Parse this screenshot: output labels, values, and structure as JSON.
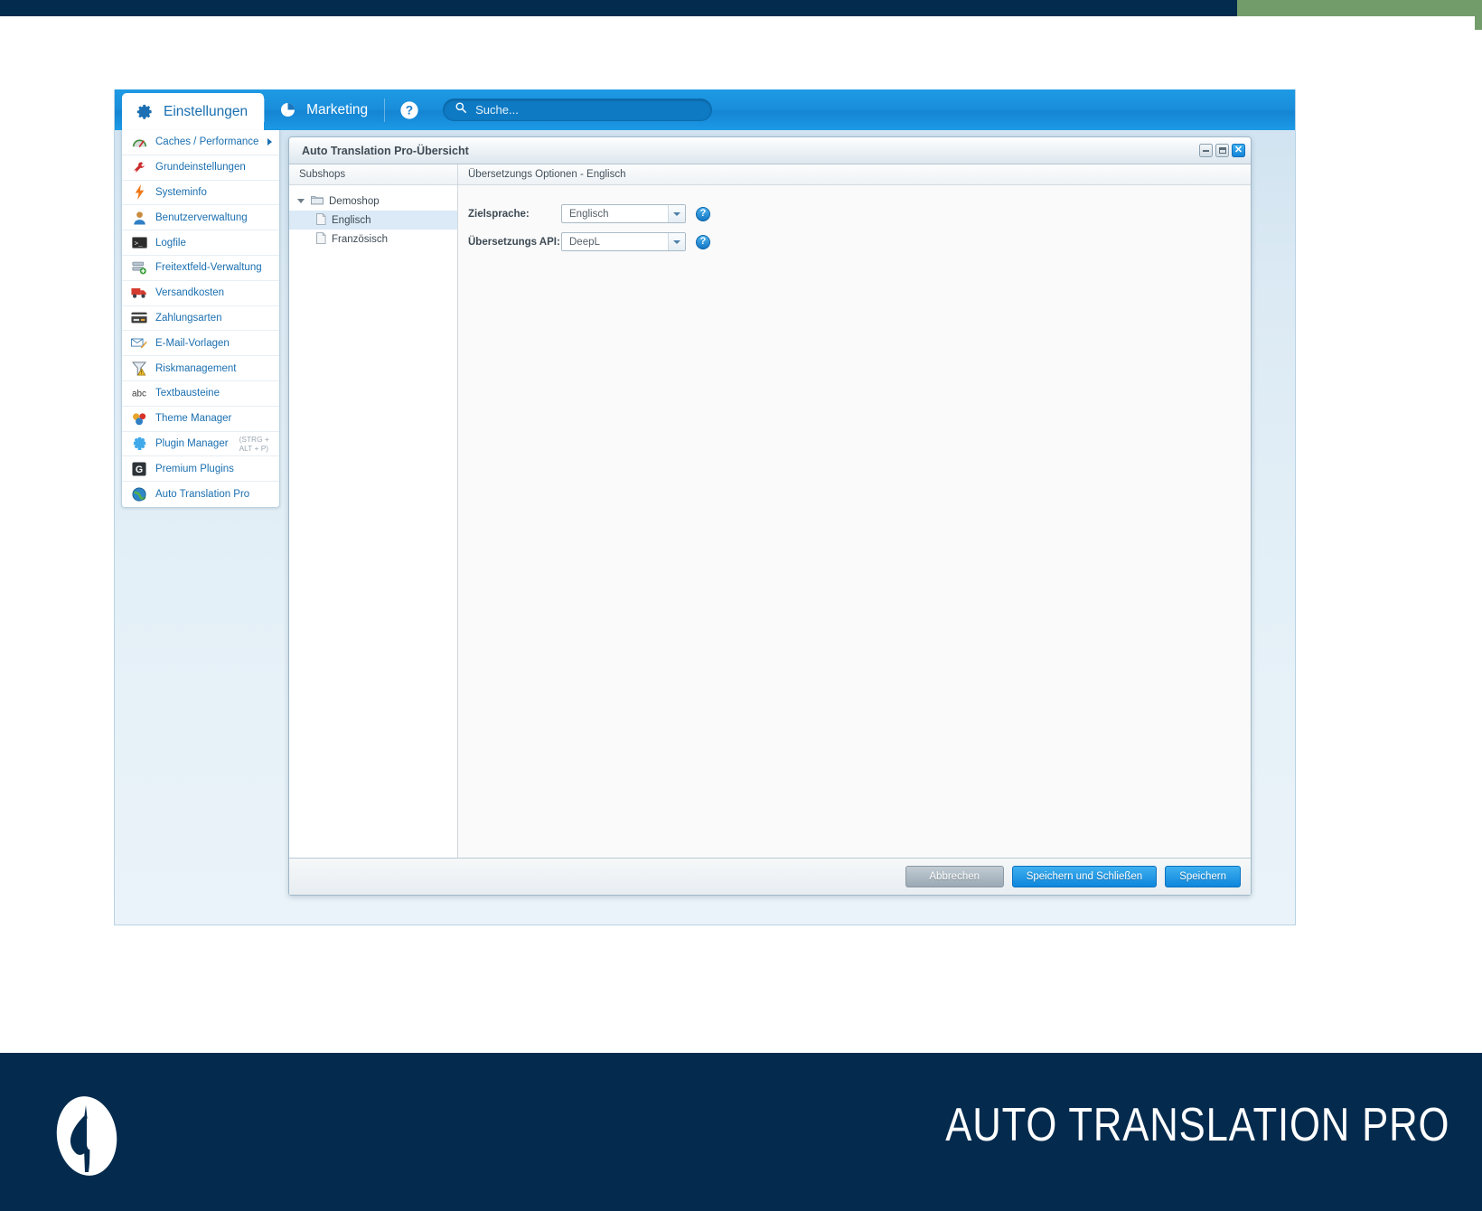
{
  "toolbar": {
    "tabs": [
      {
        "label": "Einstellungen",
        "icon": "gear-icon",
        "active": true
      },
      {
        "label": "Marketing",
        "icon": "pie-chart-icon",
        "active": false
      }
    ],
    "help_icon": "help-circle-icon",
    "search": {
      "placeholder": "Suche...",
      "value": "",
      "icon": "search-icon"
    }
  },
  "sidebar": {
    "items": [
      {
        "label": "Caches / Performance",
        "icon": "gauge-icon",
        "has_submenu": true
      },
      {
        "label": "Grundeinstellungen",
        "icon": "wrench-icon",
        "has_submenu": false
      },
      {
        "label": "Systeminfo",
        "icon": "lightning-icon",
        "has_submenu": false
      },
      {
        "label": "Benutzerverwaltung",
        "icon": "user-icon",
        "has_submenu": false
      },
      {
        "label": "Logfile",
        "icon": "console-icon",
        "has_submenu": false
      },
      {
        "label": "Freitextfeld-Verwaltung",
        "icon": "fields-add-icon",
        "has_submenu": false
      },
      {
        "label": "Versandkosten",
        "icon": "truck-icon",
        "has_submenu": false
      },
      {
        "label": "Zahlungsarten",
        "icon": "credit-card-icon",
        "has_submenu": false
      },
      {
        "label": "E-Mail-Vorlagen",
        "icon": "mail-edit-icon",
        "has_submenu": false
      },
      {
        "label": "Riskmanagement",
        "icon": "funnel-warning-icon",
        "has_submenu": false
      },
      {
        "label": "Textbausteine",
        "icon": "abc-icon",
        "has_submenu": false
      },
      {
        "label": "Theme Manager",
        "icon": "palette-icon",
        "has_submenu": false
      },
      {
        "label": "Plugin Manager",
        "hint": "(STRG + ALT + P)",
        "icon": "puzzle-icon",
        "has_submenu": false
      },
      {
        "label": "Premium Plugins",
        "icon": "premium-icon",
        "has_submenu": false
      },
      {
        "label": "Auto Translation Pro",
        "icon": "globe-icon",
        "has_submenu": false
      }
    ]
  },
  "window": {
    "title": "Auto Translation Pro-Übersicht",
    "controls": {
      "minimize": "minimize-icon",
      "maximize": "maximize-icon",
      "close": "close-icon"
    },
    "subshops": {
      "header": "Subshops",
      "tree": [
        {
          "label": "Demoshop",
          "type": "folder",
          "depth": 0,
          "expanded": true,
          "selected": false
        },
        {
          "label": "Englisch",
          "type": "file",
          "depth": 1,
          "expanded": false,
          "selected": true
        },
        {
          "label": "Französisch",
          "type": "file",
          "depth": 1,
          "expanded": false,
          "selected": false
        }
      ]
    },
    "options": {
      "header": "Übersetzungs Optionen - Englisch",
      "fields": [
        {
          "label": "Zielsprache:",
          "value": "Englisch",
          "help": "?"
        },
        {
          "label": "Übersetzungs API:",
          "value": "DeepL",
          "help": "?"
        }
      ]
    },
    "footer_buttons": [
      {
        "label": "Abbrechen",
        "style": "grey"
      },
      {
        "label": "Speichern und Schließen",
        "style": "blue"
      },
      {
        "label": "Speichern",
        "style": "blue"
      }
    ]
  },
  "brand": {
    "title": "AUTO TRANSLATION PRO",
    "logo": "leaf-logo-icon"
  },
  "colors": {
    "navy": "#042b4e",
    "green": "#739c6b",
    "accent_blue": "#1a8fdc",
    "link_blue": "#1a6fb0"
  }
}
